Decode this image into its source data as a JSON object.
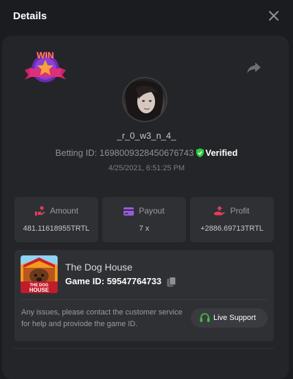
{
  "header": {
    "title": "Details",
    "close_icon": "close-icon"
  },
  "profile": {
    "badge_text": "WIN",
    "username": "_r_0_w3_n_4_",
    "betting_id_label": "Betting ID: ",
    "betting_id": "1698009328450676743",
    "verified_label": "Verified",
    "datetime": "4/25/2021, 6:51:25 PM"
  },
  "stats": [
    {
      "label": "Amount",
      "value": "481.11618955TRTL",
      "icon": "hand-coins-icon"
    },
    {
      "label": "Payout",
      "value": "7 x",
      "icon": "card-icon"
    },
    {
      "label": "Profit",
      "value": "+2886.69713TRTL",
      "icon": "profit-hand-icon"
    }
  ],
  "game": {
    "name": "The Dog House",
    "id_label": "Game ID: ",
    "id": "59547764733",
    "thumb_text_1": "THE DOG",
    "thumb_text_2": "HOUSE"
  },
  "support": {
    "message": "Any issues, please contact the customer service for help and proviode the game ID.",
    "button_label": "Live Support"
  },
  "colors": {
    "background": "#1b1c1f",
    "card": "#242528",
    "panel": "#2f3034",
    "accent_pink": "#e0405a",
    "accent_purple": "#9b59e0",
    "verified_green": "#2ecc40",
    "support_green": "#3fbf3f"
  }
}
